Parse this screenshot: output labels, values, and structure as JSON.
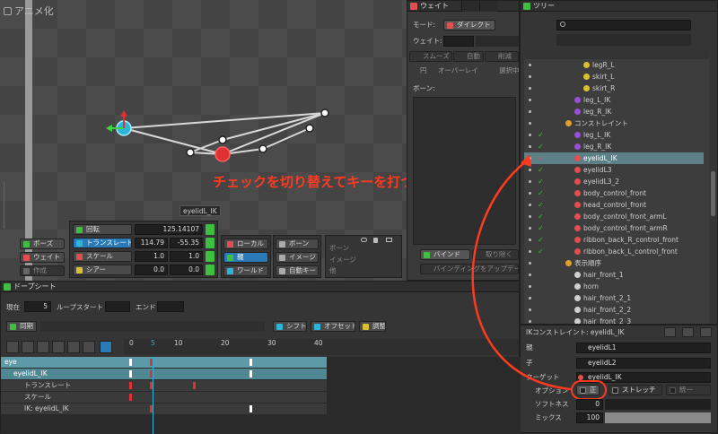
{
  "viewport": {
    "title": "アニメ化",
    "bone_label": "eyelidL_IK",
    "annotation": "チェックを切り替えてキーを打つ"
  },
  "transform": {
    "rotate": {
      "label": "回転",
      "value": "125.14107"
    },
    "translate": {
      "label": "トランスレート",
      "x": "114.79",
      "y": "-55.35"
    },
    "scale": {
      "label": "スケール",
      "x": "1.0",
      "y": "1.0"
    },
    "shear": {
      "label": "シアー",
      "x": "0.0",
      "y": "0.0"
    },
    "modes": [
      "ポーズ",
      "ウェイト",
      "作成"
    ],
    "axis": [
      "ローカル",
      "親",
      "ワールド"
    ],
    "display": [
      "ボーン",
      "イメージ",
      "自動キー"
    ],
    "toggles": [
      "ボーン",
      "イメージ",
      "他"
    ]
  },
  "weights": {
    "title": "ウェイト",
    "mode_label": "モード:",
    "mode_value": "ダイレクト",
    "weight_label": "ウェイト:",
    "smooth": "スムーズ",
    "auto": "自動",
    "prune": "削減",
    "circle": "円",
    "overlay": "オーバーレイ",
    "select": "選択中",
    "bones_label": "ボーン:",
    "bind": "バインド",
    "remove": "取り除く",
    "update": "バインディングをアップデート"
  },
  "tree": {
    "title": "ツリー",
    "items": [
      {
        "name": "legR_L",
        "indent": 1,
        "icon": "bone"
      },
      {
        "name": "skirt_L",
        "indent": 1,
        "icon": "bone"
      },
      {
        "name": "skirt_R",
        "indent": 1,
        "icon": "bone"
      },
      {
        "name": "leg_L_IK",
        "indent": 0,
        "icon": "ik"
      },
      {
        "name": "leg_R_IK",
        "indent": 0,
        "icon": "ik"
      },
      {
        "name": "コンストレイント",
        "indent": -1,
        "icon": "folder"
      },
      {
        "name": "leg_L_IK",
        "indent": 0,
        "icon": "ik"
      },
      {
        "name": "leg_R_IK",
        "indent": 0,
        "icon": "ik"
      },
      {
        "name": "eyelidL_IK",
        "indent": 0,
        "icon": "ik-red"
      },
      {
        "name": "eyelidL3",
        "indent": 0,
        "icon": "ik-red"
      },
      {
        "name": "eyelidL3_2",
        "indent": 0,
        "icon": "ik-red"
      },
      {
        "name": "body_control_front",
        "indent": 0,
        "icon": "t"
      },
      {
        "name": "head_control_front",
        "indent": 0,
        "icon": "t"
      },
      {
        "name": "body_control_front_armL",
        "indent": 0,
        "icon": "t"
      },
      {
        "name": "body_control_front_armR",
        "indent": 0,
        "icon": "t"
      },
      {
        "name": "ribbon_back_R_control_front",
        "indent": 0,
        "icon": "t"
      },
      {
        "name": "ribbon_back_L_control_front",
        "indent": 0,
        "icon": "t"
      },
      {
        "name": "表示順序",
        "indent": -1,
        "icon": "folder"
      },
      {
        "name": "hair_front_1",
        "indent": 0,
        "icon": "slot"
      },
      {
        "name": "horn",
        "indent": 0,
        "icon": "slot"
      },
      {
        "name": "hair_front_2_1",
        "indent": 0,
        "icon": "slot"
      },
      {
        "name": "hair_front_2_2",
        "indent": 0,
        "icon": "slot"
      },
      {
        "name": "hair_front_2_3",
        "indent": 0,
        "icon": "slot"
      }
    ]
  },
  "ik": {
    "title": "IKコンストレイント: eyelidL_IK",
    "parent_label": "親",
    "parent_value": "eyelidL1",
    "child_label": "子",
    "child_value": "eyelidL2",
    "target_label": "ターゲット",
    "target_value": "eyelidL_IK",
    "option_label": "オプション",
    "positive": "正",
    "stretch": "ストレッチ",
    "uniform": "統一",
    "softness_label": "ソフトネス",
    "softness_value": "0",
    "mix_label": "ミックス",
    "mix_value": "100",
    "mix": 1.0
  },
  "dopesheet": {
    "title": "ドープシート",
    "current_label": "現在",
    "current_value": "5",
    "loop_start": "ループスタート",
    "end": "エンド",
    "sync": "同期",
    "shift": "シフト",
    "offset": "オフセット",
    "adjust": "調整",
    "ticks": [
      "0",
      "10",
      "20",
      "30",
      "40"
    ],
    "playhead": "5",
    "tracks": [
      {
        "name": "eye",
        "level": 0
      },
      {
        "name": "eyelidL_IK",
        "level": 1
      },
      {
        "name": "トランスレート",
        "level": 2
      },
      {
        "name": "スケール",
        "level": 2
      },
      {
        "name": "IK: eyelidL_IK",
        "level": 2
      }
    ]
  }
}
